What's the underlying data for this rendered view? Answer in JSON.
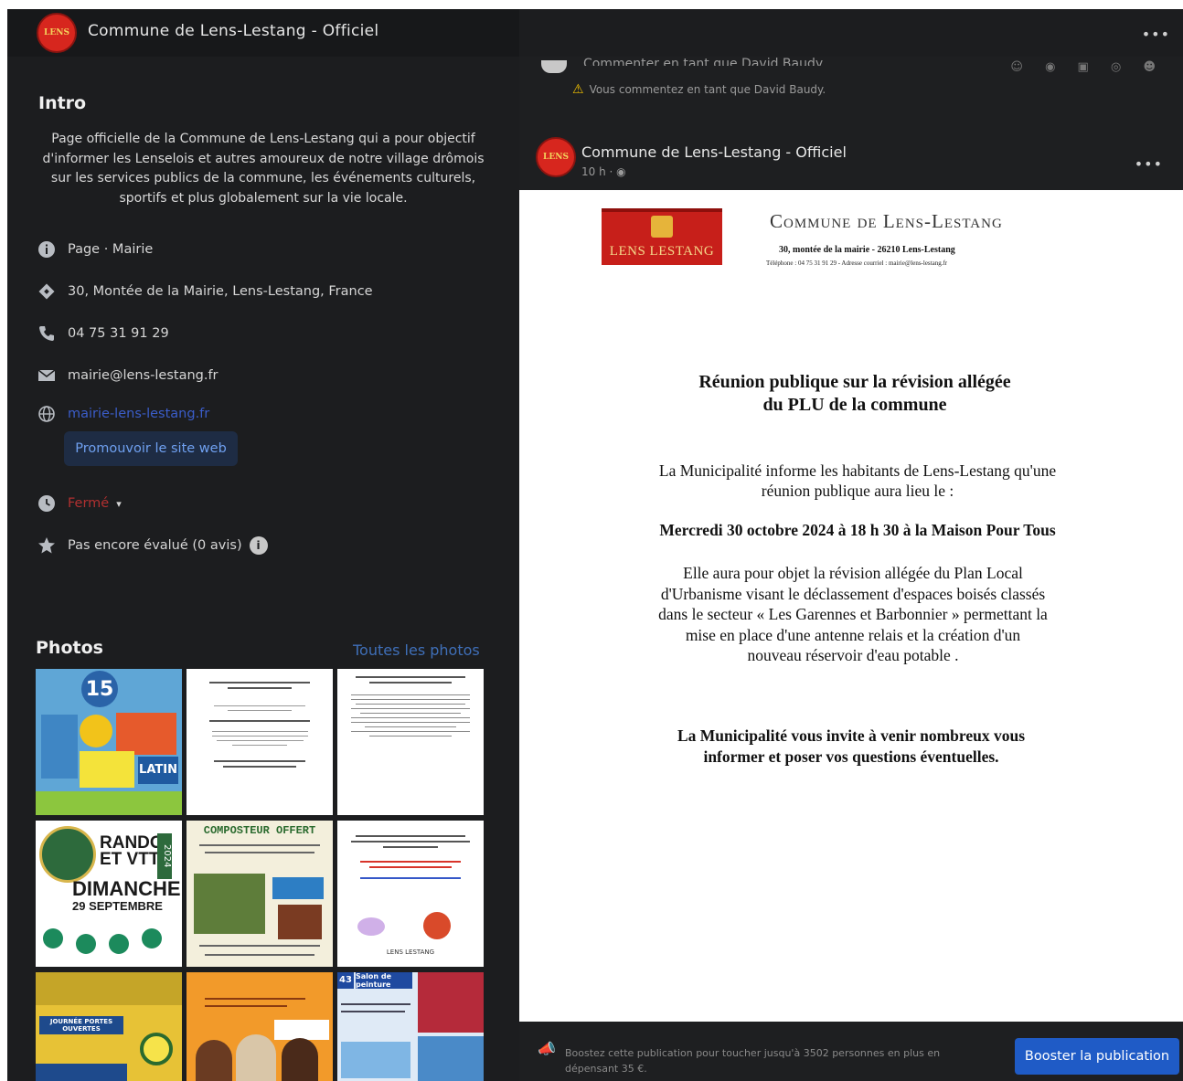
{
  "header": {
    "page_name": "Commune de Lens-Lestang - Officiel",
    "logo_text": "LENS",
    "more_label": "•••"
  },
  "intro": {
    "heading": "Intro",
    "description": "Page officielle de la Commune de Lens-Lestang qui a pour objectif d'informer les Lenselois et autres amoureux de notre village drômois sur les services publics de la commune, les événements culturels, sportifs et plus globalement sur la vie locale."
  },
  "info": {
    "category": "Page · Mairie",
    "address": "30, Montée de la Mairie, Lens-Lestang, France",
    "phone": "04 75 31 91 29",
    "email": "mairie@lens-lestang.fr",
    "website": "mairie-lens-lestang.fr",
    "promote_label": "Promouvoir le site web",
    "hours_status": "Fermé",
    "rating": "Pas encore évalué (0 avis)",
    "icons": {
      "info": "info-icon",
      "address": "location-icon",
      "phone": "phone-icon",
      "email": "email-icon",
      "website": "globe-icon",
      "hours": "clock-icon",
      "rating": "star-icon"
    }
  },
  "photos": {
    "heading": "Photos",
    "all_link": "Toutes les photos",
    "items": [
      {
        "id": "p1",
        "caption": "15",
        "text1": "LATIN"
      },
      {
        "id": "p2"
      },
      {
        "id": "p3"
      },
      {
        "id": "p4",
        "caption": "RANDO ET VTT",
        "text1": "DIMANCHE",
        "text2": "29 SEPTEMBRE",
        "year": "2024"
      },
      {
        "id": "p5",
        "caption": "COMPOSTEUR OFFERT"
      },
      {
        "id": "p6",
        "text1": "LENS LESTANG"
      },
      {
        "id": "p7",
        "caption": "JOURNÉE PORTES OUVERTES"
      },
      {
        "id": "p8"
      },
      {
        "id": "p9",
        "caption": "Salon de peinture",
        "text1": "43"
      }
    ]
  },
  "comment": {
    "placeholder": "Commenter en tant que David Baudy",
    "warning": "Vous commentez en tant que David Baudy."
  },
  "post": {
    "author": "Commune de Lens-Lestang - Officiel",
    "time": "10 h ·",
    "more_label": "•••"
  },
  "document": {
    "logo_text": "LENS LESTANG",
    "org": "Commune de Lens-Lestang",
    "address": "30, montée de la mairie - 26210 Lens-Lestang",
    "contact": "Téléphone : 04 75 31 91 29 - Adresse courriel : mairie@lens-lestang.fr",
    "title_line1": "Réunion publique sur la révision allégée",
    "title_line2": "du PLU de la commune",
    "p1_line1": "La Municipalité informe les habitants de Lens-Lestang qu'une",
    "p1_line2": "réunion publique aura lieu le :",
    "date": "Mercredi 30 octobre 2024 à 18 h 30 à la Maison Pour Tous",
    "p2_line1": "Elle aura pour objet la révision allégée du Plan Local",
    "p2_line2": "d'Urbanisme visant le déclassement d'espaces boisés classés",
    "p2_line3": "dans le secteur « Les Garennes et Barbonnier » permettant la",
    "p2_line4": "mise en place d'une antenne relais et la création d'un",
    "p2_line5": "nouveau réservoir d'eau potable .",
    "invite_line1": "La Municipalité vous invite à venir nombreux vous",
    "invite_line2": "informer et poser vos questions éventuelles."
  },
  "boost": {
    "text": "Boostez cette publication pour toucher jusqu'à 3502 personnes en plus en dépensant 35 €.",
    "button": "Booster la publication"
  }
}
